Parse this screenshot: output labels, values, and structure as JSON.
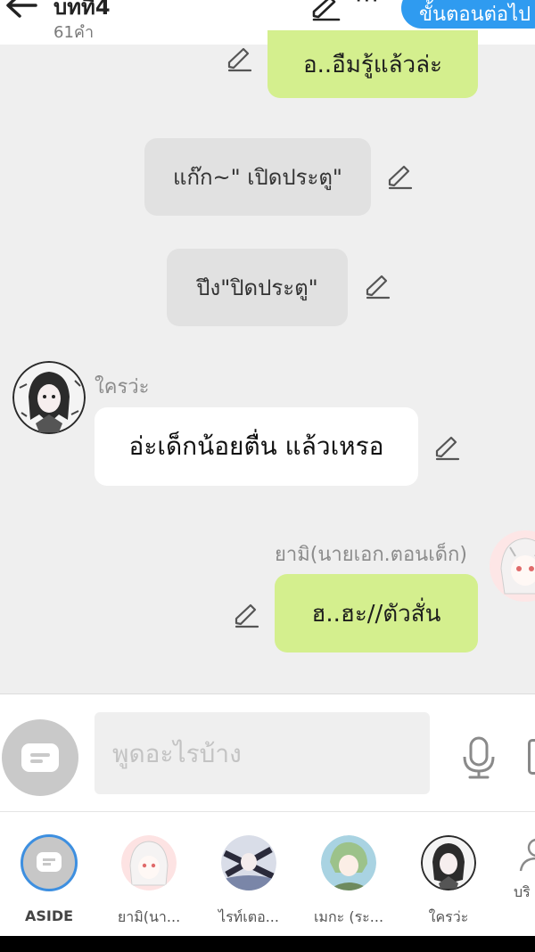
{
  "header": {
    "title": "บทที่4",
    "word_count": "61คำ",
    "next_button": "ขั้นตอนต่อไป",
    "more_label": "···"
  },
  "messages": [
    {
      "type": "green",
      "text": "อ..อืมรู้แล้วล่ะ"
    },
    {
      "type": "narration",
      "text": "แก๊ก~\" เปิดประตู\""
    },
    {
      "type": "narration",
      "text": "ปึง\"ปิดประตู\""
    },
    {
      "type": "left",
      "speaker": "ใครว่ะ",
      "text": "อ่ะเด็กน้อยตื่น แล้วเหรอ"
    },
    {
      "type": "right",
      "speaker": "ยามิ(นายเอก.ตอนเด็ก)",
      "text": "ฮ..ฮะ//ตัวสั่น"
    }
  ],
  "composer": {
    "placeholder": "พูดอะไรบ้าง"
  },
  "characters": [
    {
      "label": "ASIDE"
    },
    {
      "label": "ยามิ(นา..."
    },
    {
      "label": "ไรท์เตอ..."
    },
    {
      "label": "เมกะ (ระ..."
    },
    {
      "label": "ใครว่ะ"
    },
    {
      "label": "บริ"
    }
  ],
  "colors": {
    "accent": "#2f9bf0",
    "bubble_self": "#d4ef8e",
    "background": "#efefef"
  }
}
